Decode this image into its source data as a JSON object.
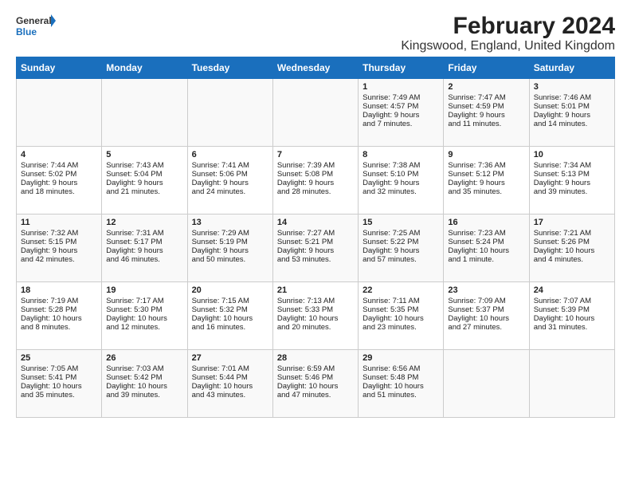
{
  "logo": {
    "general": "General",
    "blue": "Blue"
  },
  "title": "February 2024",
  "subtitle": "Kingswood, England, United Kingdom",
  "days": [
    "Sunday",
    "Monday",
    "Tuesday",
    "Wednesday",
    "Thursday",
    "Friday",
    "Saturday"
  ],
  "weeks": [
    [
      {
        "day": "",
        "content": ""
      },
      {
        "day": "",
        "content": ""
      },
      {
        "day": "",
        "content": ""
      },
      {
        "day": "",
        "content": ""
      },
      {
        "day": "1",
        "content": "Sunrise: 7:49 AM\nSunset: 4:57 PM\nDaylight: 9 hours\nand 7 minutes."
      },
      {
        "day": "2",
        "content": "Sunrise: 7:47 AM\nSunset: 4:59 PM\nDaylight: 9 hours\nand 11 minutes."
      },
      {
        "day": "3",
        "content": "Sunrise: 7:46 AM\nSunset: 5:01 PM\nDaylight: 9 hours\nand 14 minutes."
      }
    ],
    [
      {
        "day": "4",
        "content": "Sunrise: 7:44 AM\nSunset: 5:02 PM\nDaylight: 9 hours\nand 18 minutes."
      },
      {
        "day": "5",
        "content": "Sunrise: 7:43 AM\nSunset: 5:04 PM\nDaylight: 9 hours\nand 21 minutes."
      },
      {
        "day": "6",
        "content": "Sunrise: 7:41 AM\nSunset: 5:06 PM\nDaylight: 9 hours\nand 24 minutes."
      },
      {
        "day": "7",
        "content": "Sunrise: 7:39 AM\nSunset: 5:08 PM\nDaylight: 9 hours\nand 28 minutes."
      },
      {
        "day": "8",
        "content": "Sunrise: 7:38 AM\nSunset: 5:10 PM\nDaylight: 9 hours\nand 32 minutes."
      },
      {
        "day": "9",
        "content": "Sunrise: 7:36 AM\nSunset: 5:12 PM\nDaylight: 9 hours\nand 35 minutes."
      },
      {
        "day": "10",
        "content": "Sunrise: 7:34 AM\nSunset: 5:13 PM\nDaylight: 9 hours\nand 39 minutes."
      }
    ],
    [
      {
        "day": "11",
        "content": "Sunrise: 7:32 AM\nSunset: 5:15 PM\nDaylight: 9 hours\nand 42 minutes."
      },
      {
        "day": "12",
        "content": "Sunrise: 7:31 AM\nSunset: 5:17 PM\nDaylight: 9 hours\nand 46 minutes."
      },
      {
        "day": "13",
        "content": "Sunrise: 7:29 AM\nSunset: 5:19 PM\nDaylight: 9 hours\nand 50 minutes."
      },
      {
        "day": "14",
        "content": "Sunrise: 7:27 AM\nSunset: 5:21 PM\nDaylight: 9 hours\nand 53 minutes."
      },
      {
        "day": "15",
        "content": "Sunrise: 7:25 AM\nSunset: 5:22 PM\nDaylight: 9 hours\nand 57 minutes."
      },
      {
        "day": "16",
        "content": "Sunrise: 7:23 AM\nSunset: 5:24 PM\nDaylight: 10 hours\nand 1 minute."
      },
      {
        "day": "17",
        "content": "Sunrise: 7:21 AM\nSunset: 5:26 PM\nDaylight: 10 hours\nand 4 minutes."
      }
    ],
    [
      {
        "day": "18",
        "content": "Sunrise: 7:19 AM\nSunset: 5:28 PM\nDaylight: 10 hours\nand 8 minutes."
      },
      {
        "day": "19",
        "content": "Sunrise: 7:17 AM\nSunset: 5:30 PM\nDaylight: 10 hours\nand 12 minutes."
      },
      {
        "day": "20",
        "content": "Sunrise: 7:15 AM\nSunset: 5:32 PM\nDaylight: 10 hours\nand 16 minutes."
      },
      {
        "day": "21",
        "content": "Sunrise: 7:13 AM\nSunset: 5:33 PM\nDaylight: 10 hours\nand 20 minutes."
      },
      {
        "day": "22",
        "content": "Sunrise: 7:11 AM\nSunset: 5:35 PM\nDaylight: 10 hours\nand 23 minutes."
      },
      {
        "day": "23",
        "content": "Sunrise: 7:09 AM\nSunset: 5:37 PM\nDaylight: 10 hours\nand 27 minutes."
      },
      {
        "day": "24",
        "content": "Sunrise: 7:07 AM\nSunset: 5:39 PM\nDaylight: 10 hours\nand 31 minutes."
      }
    ],
    [
      {
        "day": "25",
        "content": "Sunrise: 7:05 AM\nSunset: 5:41 PM\nDaylight: 10 hours\nand 35 minutes."
      },
      {
        "day": "26",
        "content": "Sunrise: 7:03 AM\nSunset: 5:42 PM\nDaylight: 10 hours\nand 39 minutes."
      },
      {
        "day": "27",
        "content": "Sunrise: 7:01 AM\nSunset: 5:44 PM\nDaylight: 10 hours\nand 43 minutes."
      },
      {
        "day": "28",
        "content": "Sunrise: 6:59 AM\nSunset: 5:46 PM\nDaylight: 10 hours\nand 47 minutes."
      },
      {
        "day": "29",
        "content": "Sunrise: 6:56 AM\nSunset: 5:48 PM\nDaylight: 10 hours\nand 51 minutes."
      },
      {
        "day": "",
        "content": ""
      },
      {
        "day": "",
        "content": ""
      }
    ]
  ]
}
